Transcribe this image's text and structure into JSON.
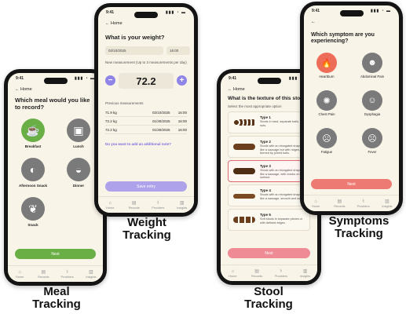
{
  "status": {
    "time": "9:41",
    "signal": "▮▮▮ ◔ ▬"
  },
  "nav": [
    {
      "label": "Home",
      "icon": "⌂"
    },
    {
      "label": "Records",
      "icon": "▤"
    },
    {
      "label": "Providers",
      "icon": "⚕"
    },
    {
      "label": "Insights",
      "icon": "▥"
    }
  ],
  "meal": {
    "back": "← Home",
    "question": "Which meal would you like to record?",
    "options": [
      {
        "label": "Breakfast",
        "icon": "☕"
      },
      {
        "label": "Lunch",
        "icon": "▣"
      },
      {
        "label": "Afternoon Snack",
        "icon": "◐"
      },
      {
        "label": "Dinner",
        "icon": "◒"
      },
      {
        "label": "Snack",
        "icon": "❦"
      }
    ],
    "next_label": "Next",
    "caption_line1": "Meal",
    "caption_line2": "Tracking"
  },
  "weight": {
    "back": "← Home",
    "question": "What is your weight?",
    "date": "02/10/2025",
    "time": "16:00",
    "measurement_label": "New measurement (Up to 3 measurements per day)",
    "value": "72.2",
    "previous_title": "Previous measurements",
    "previous": [
      {
        "weight": "71.9 kg",
        "date": "02/10/2025",
        "time": "16:00"
      },
      {
        "weight": "72.2 kg",
        "date": "01/30/2025",
        "time": "16:00"
      },
      {
        "weight": "72.2 kg",
        "date": "01/30/2025",
        "time": "16:00"
      }
    ],
    "add_note": "Do you want to add an additional note?",
    "save_label": "Save entry",
    "caption_line1": "Weight",
    "caption_line2": "Tracking"
  },
  "stool": {
    "back": "← Home",
    "question": "What is the texture of this stool?",
    "instruction": "Select the most appropriate option",
    "types": [
      {
        "title": "Type 1",
        "desc": "Stools in hard, separate balls. Like nuts."
      },
      {
        "title": "Type 2",
        "desc": "Stools with an elongated shape like a sausage but with ridges, as if formed by joined balls."
      },
      {
        "title": "Type 3",
        "desc": "Stools with an elongated shape like a sausage, with cracks on the surface."
      },
      {
        "title": "Type 4",
        "desc": "Stools with an elongated shape like a sausage, smooth and soft."
      },
      {
        "title": "Type 5",
        "desc": "Soft stools in separate pieces or with defined edges."
      }
    ],
    "next_label": "Next",
    "caption_line1": "Stool",
    "caption_line2": "Tracking"
  },
  "symptoms": {
    "question": "Which symptom are you experiencing?",
    "options": [
      {
        "label": "Heartburn",
        "icon": "🔥"
      },
      {
        "label": "Abdominal Pain",
        "icon": "☻"
      },
      {
        "label": "Chest Pain",
        "icon": "✺"
      },
      {
        "label": "Dysphagia",
        "icon": "☺"
      },
      {
        "label": "Fatigue",
        "icon": "☹"
      },
      {
        "label": "Fever",
        "icon": "☹"
      }
    ],
    "next_label": "Next",
    "caption_line1": "Symptoms",
    "caption_line2": "Tracking"
  },
  "colors": {
    "meal_accent": "#6aae46",
    "weight_accent": "#8f84e8",
    "stool_accent": "#ef8b94",
    "symptom_accent": "#ee6d59"
  }
}
